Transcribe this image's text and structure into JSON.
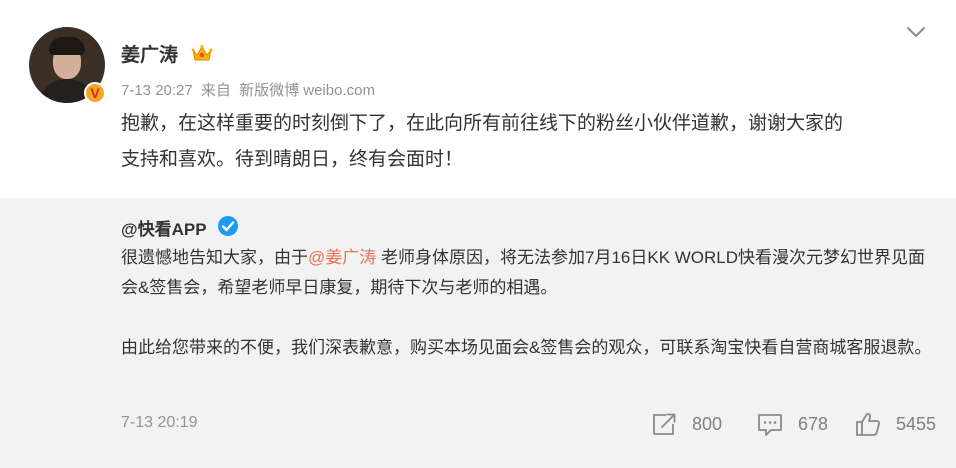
{
  "post": {
    "author": "姜广涛",
    "time": "7-13 20:27",
    "source_prefix": "来自",
    "source": "新版微博 weibo.com",
    "text_line1": "抱歉，在这样重要的时刻倒下了，在此向所有前往线下的粉丝小伙伴道歉，谢谢大家的",
    "text_line2": "支持和喜欢。待到晴朗日，终有会面时！",
    "badge_letter": "V"
  },
  "repost": {
    "author": "@快看APP",
    "p1_before": "很遗憾地告知大家，由于",
    "p1_mention": "@姜广涛",
    "p1_after": " 老师身体原因，将无法参加7月16日KK WORLD快看漫次元梦幻世界见面会&签售会，希望老师早日康复，期待下次与老师的相遇。",
    "p2": "由此给您带来的不便，我们深表歉意，购买本场见面会&签售会的观众，可联系淘宝快看自营商城客服退款。",
    "time": "7-13 20:19",
    "share_count": "800",
    "comment_count": "678",
    "like_count": "5455"
  },
  "icons": {
    "avatar_badge": "verified-v-icon",
    "crown": "crown-icon",
    "dropdown": "chevron-down-icon",
    "blue_verified": "blue-verified-icon",
    "share": "share-icon",
    "comment": "comment-icon",
    "like": "thumbs-up-icon"
  },
  "colors": {
    "mention": "#eb7350",
    "meta_gray": "#939393",
    "repost_bg": "#f2f2f2",
    "verified_blue": "#1d9bf0",
    "badge_orange": "#f5a623"
  }
}
